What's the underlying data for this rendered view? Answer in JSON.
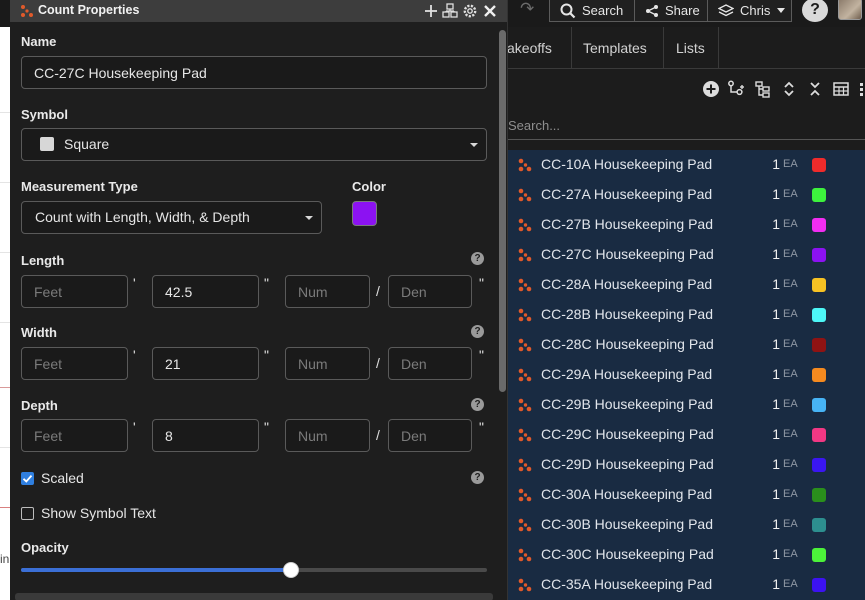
{
  "topbar": {
    "search_label": "Search",
    "share_label": "Share",
    "user_label": "Chris",
    "help_label": "?"
  },
  "tabs": [
    {
      "label": "akeoffs"
    },
    {
      "label": "Templates"
    },
    {
      "label": "Lists"
    }
  ],
  "list_search": {
    "placeholder": "Search..."
  },
  "items": [
    {
      "name": "CC-10A Housekeeping Pad",
      "qty": "1",
      "unit": "EA",
      "color": "#ef2b2b"
    },
    {
      "name": "CC-27A Housekeeping Pad",
      "qty": "1",
      "unit": "EA",
      "color": "#3df23d"
    },
    {
      "name": "CC-27B Housekeeping Pad",
      "qty": "1",
      "unit": "EA",
      "color": "#f22df2"
    },
    {
      "name": "CC-27C Housekeeping Pad",
      "qty": "1",
      "unit": "EA",
      "color": "#8c12f2"
    },
    {
      "name": "CC-28A Housekeeping Pad",
      "qty": "1",
      "unit": "EA",
      "color": "#f7c223"
    },
    {
      "name": "CC-28B Housekeeping Pad",
      "qty": "1",
      "unit": "EA",
      "color": "#4df7f7"
    },
    {
      "name": "CC-28C Housekeeping Pad",
      "qty": "1",
      "unit": "EA",
      "color": "#8f1313"
    },
    {
      "name": "CC-29A Housekeeping Pad",
      "qty": "1",
      "unit": "EA",
      "color": "#f58a1f"
    },
    {
      "name": "CC-29B Housekeeping Pad",
      "qty": "1",
      "unit": "EA",
      "color": "#47b4f5"
    },
    {
      "name": "CC-29C Housekeeping Pad",
      "qty": "1",
      "unit": "EA",
      "color": "#f23884"
    },
    {
      "name": "CC-29D Housekeeping Pad",
      "qty": "1",
      "unit": "EA",
      "color": "#3a16f2"
    },
    {
      "name": "CC-30A Housekeeping Pad",
      "qty": "1",
      "unit": "EA",
      "color": "#2a8f1c"
    },
    {
      "name": "CC-30B Housekeeping Pad",
      "qty": "1",
      "unit": "EA",
      "color": "#2d8f8f"
    },
    {
      "name": "CC-30C Housekeeping Pad",
      "qty": "1",
      "unit": "EA",
      "color": "#4cf23a"
    },
    {
      "name": "CC-35A Housekeeping Pad",
      "qty": "1",
      "unit": "EA",
      "color": "#3c12f2"
    }
  ],
  "dialog": {
    "title": "Count Properties",
    "name_label": "Name",
    "name_value": "CC-27C Housekeeping Pad",
    "symbol_label": "Symbol",
    "symbol_value": "Square",
    "measurement_label": "Measurement Type",
    "measurement_value": "Count with Length, Width, & Depth",
    "color_label": "Color",
    "color_value": "#8c12f2",
    "feet_placeholder": "Feet",
    "num_placeholder": "Num",
    "den_placeholder": "Den",
    "feet_mark": "'",
    "inch_mark": "\"",
    "frac_slash": "/",
    "help_mark": "?",
    "length_label": "Length",
    "length_inches": "42.5",
    "width_label": "Width",
    "width_inches": "21",
    "depth_label": "Depth",
    "depth_inches": "8",
    "scaled_label": "Scaled",
    "scaled_checked": true,
    "show_symbol_text_label": "Show Symbol Text",
    "show_symbol_text_checked": false,
    "opacity_label": "Opacity",
    "opacity_fraction": 0.58
  },
  "background_strip": {
    "text": "in"
  }
}
